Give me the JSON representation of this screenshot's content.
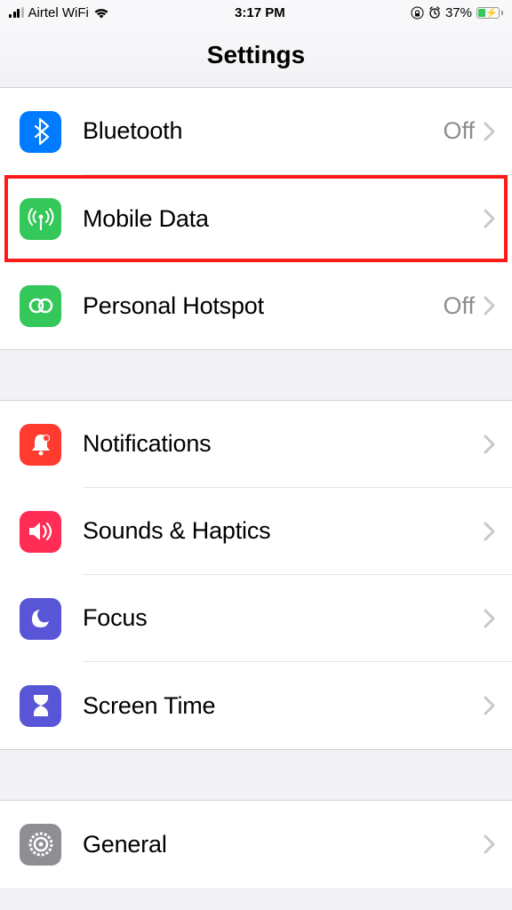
{
  "status": {
    "carrier": "Airtel WiFi",
    "time": "3:17 PM",
    "battery": "37%"
  },
  "header": {
    "title": "Settings"
  },
  "group1": {
    "bluetooth": {
      "label": "Bluetooth",
      "value": "Off"
    },
    "mobiledata": {
      "label": "Mobile Data"
    },
    "hotspot": {
      "label": "Personal Hotspot",
      "value": "Off"
    }
  },
  "group2": {
    "notifications": {
      "label": "Notifications"
    },
    "sounds": {
      "label": "Sounds & Haptics"
    },
    "focus": {
      "label": "Focus"
    },
    "screentime": {
      "label": "Screen Time"
    }
  },
  "group3": {
    "general": {
      "label": "General"
    }
  }
}
